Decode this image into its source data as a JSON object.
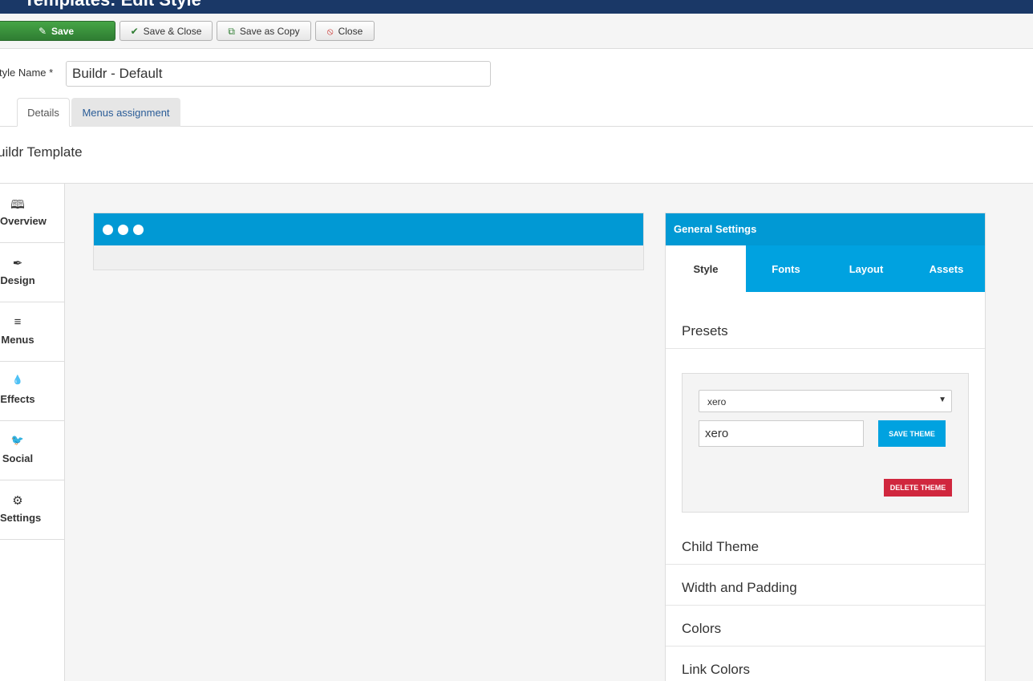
{
  "window": {
    "title": "Templates: Edit Style"
  },
  "toolbar": {
    "save_label": "Save",
    "save_close_label": "Save & Close",
    "save_copy_label": "Save as Copy",
    "close_label": "Close"
  },
  "form": {
    "style_name_label": "tyle Name *",
    "style_name_value": "Buildr - Default"
  },
  "tabs": [
    {
      "label": "Details",
      "active": true
    },
    {
      "label": "Menus assignment",
      "active": false
    }
  ],
  "template_title": "uildr Template",
  "sidebar": {
    "items": [
      {
        "label": "Overview",
        "icon": "book-icon"
      },
      {
        "label": "Design",
        "icon": "feather-icon"
      },
      {
        "label": "Menus",
        "icon": "menu-icon"
      },
      {
        "label": "Effects",
        "icon": "drops-icon"
      },
      {
        "label": "Social",
        "icon": "twitter-icon"
      },
      {
        "label": "Settings",
        "icon": "gear-icon"
      }
    ]
  },
  "settings": {
    "header": "General Settings",
    "tabs": [
      {
        "label": "Style",
        "active": true
      },
      {
        "label": "Fonts",
        "active": false
      },
      {
        "label": "Layout",
        "active": false
      },
      {
        "label": "Assets",
        "active": false
      }
    ],
    "sections": {
      "presets": "Presets",
      "child_theme": "Child Theme",
      "width_padding": "Width and Padding",
      "colors": "Colors",
      "link_colors": "Link Colors"
    },
    "preset_select_value": "xero",
    "preset_name_value": "xero",
    "save_theme_label": "SAVE THEME",
    "delete_theme_label": "DELETE THEME"
  },
  "colors": {
    "topbar": "#1a3867",
    "save_green": "#3b8f3e",
    "accent_blue": "#00a2e0",
    "delete_red": "#d0273e"
  }
}
